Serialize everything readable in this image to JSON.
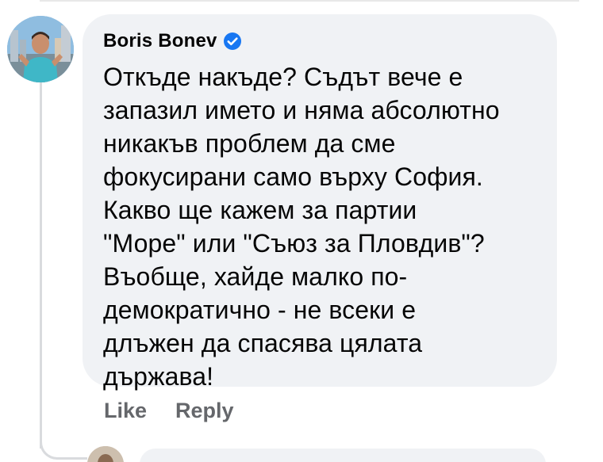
{
  "comment": {
    "author": "Boris Bonev",
    "verified": true,
    "text": "Откъде накъде? Съдът вече е\nзапазил името и няма абсолютно\nникакъв проблем да сме\nфокусирани само върху София.\nКакво ще кажем за партии\n\"Море\" или \"Съюз за Пловдив\"?\nВъобще, хайде малко по-\nдемократично - не всеки е\nдлъжен да спасява цялата\nдържава!"
  },
  "actions": {
    "like_label": "Like",
    "reply_label": "Reply"
  },
  "icons": {
    "verified": "verified-badge-icon"
  },
  "colors": {
    "bubble_bg": "#f0f2f5",
    "text": "#050505",
    "action_text": "#65676b",
    "verified_blue": "#1877f2",
    "thread_line": "#d9dbde"
  }
}
